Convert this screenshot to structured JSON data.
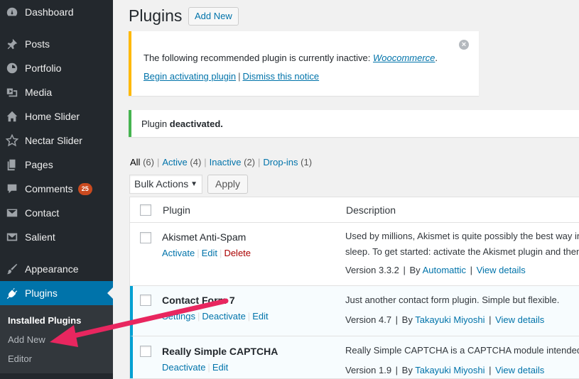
{
  "sidebar": {
    "items": [
      {
        "label": "Dashboard",
        "icon": "dashboard-icon"
      },
      {
        "label": "Posts",
        "icon": "pin-icon"
      },
      {
        "label": "Portfolio",
        "icon": "portfolio-icon"
      },
      {
        "label": "Media",
        "icon": "media-icon"
      },
      {
        "label": "Home Slider",
        "icon": "home-icon"
      },
      {
        "label": "Nectar Slider",
        "icon": "star-icon"
      },
      {
        "label": "Pages",
        "icon": "pages-icon"
      },
      {
        "label": "Comments",
        "icon": "comment-icon",
        "badge": "25"
      },
      {
        "label": "Contact",
        "icon": "envelope-icon"
      },
      {
        "label": "Salient",
        "icon": "salient-icon"
      },
      {
        "label": "Appearance",
        "icon": "brush-icon"
      },
      {
        "label": "Plugins",
        "icon": "plugin-icon"
      }
    ],
    "submenu": [
      "Installed Plugins",
      "Add New",
      "Editor"
    ]
  },
  "header": {
    "title": "Plugins",
    "add_new": "Add New"
  },
  "notice_recommend": {
    "text_before": "The following recommended plugin is currently inactive: ",
    "plugin_link": "Woocommerce",
    "text_after": ".",
    "begin_link": "Begin activating plugin",
    "separator": "|",
    "dismiss_link": "Dismiss this notice"
  },
  "notice_deactivated": {
    "text": "Plugin ",
    "bold": "deactivated."
  },
  "filters": {
    "all": "All",
    "all_count": "(6)",
    "active": "Active",
    "active_count": "(4)",
    "inactive": "Inactive",
    "inactive_count": "(2)",
    "dropins": "Drop-ins",
    "dropins_count": "(1)",
    "separator": "|"
  },
  "bulk": {
    "select_value": "Bulk Actions",
    "apply": "Apply"
  },
  "table": {
    "col_plugin": "Plugin",
    "col_description": "Description",
    "rows": [
      {
        "name": "Akismet Anti-Spam",
        "actions": [
          "Activate",
          "Edit",
          "Delete"
        ],
        "desc_line1": "Used by millions, Akismet is quite possibly the best way in",
        "desc_line2": "sleep. To get started: activate the Akismet plugin and then",
        "version": "Version 3.3.2",
        "by": "By",
        "author": "Automattic",
        "details": "View details"
      },
      {
        "name": "Contact Form 7",
        "actions": [
          "Settings",
          "Deactivate",
          "Edit"
        ],
        "desc_line1": "Just another contact form plugin. Simple but flexible.",
        "version": "Version 4.7",
        "by": "By",
        "author": "Takayuki Miyoshi",
        "details": "View details"
      },
      {
        "name": "Really Simple CAPTCHA",
        "actions": [
          "Deactivate",
          "Edit"
        ],
        "desc_line1": "Really Simple CAPTCHA is a CAPTCHA module intended to",
        "version": "Version 1.9",
        "by": "By",
        "author": "Takayuki Miyoshi",
        "details": "View details"
      }
    ]
  },
  "colors": {
    "sidebar_bg": "#23282d",
    "active_menu": "#0073aa",
    "link": "#0073aa",
    "warning_border": "#ffb900",
    "success_border": "#46b450",
    "badge": "#ca4a1f",
    "arrow": "#e8265f"
  }
}
